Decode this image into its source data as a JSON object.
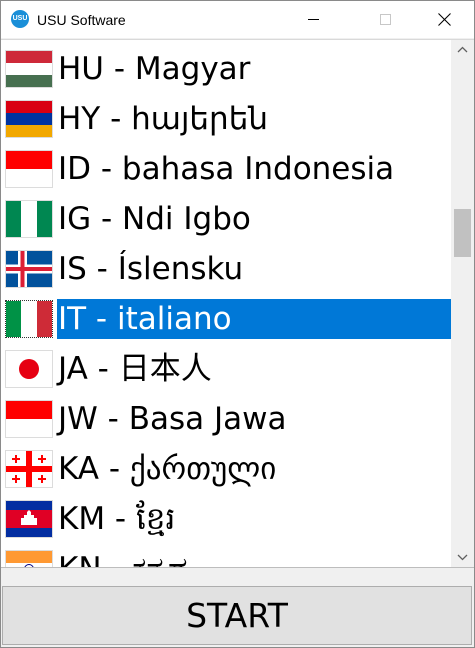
{
  "window": {
    "title": "USU Software",
    "icon_text": "USU",
    "controls": [
      "minimize",
      "maximize",
      "close"
    ]
  },
  "languages": {
    "selected_index": 5,
    "items": [
      {
        "label": "HU - Magyar",
        "flag": "flag-hungary-icon"
      },
      {
        "label": "HY - հայերեն",
        "flag": "flag-armenia-icon"
      },
      {
        "label": "ID - bahasa Indonesia",
        "flag": "flag-indonesia-icon"
      },
      {
        "label": "IG - Ndi Igbo",
        "flag": "flag-nigeria-icon"
      },
      {
        "label": "IS - Íslensku",
        "flag": "flag-iceland-icon"
      },
      {
        "label": "IT - italiano",
        "flag": "flag-italy-icon"
      },
      {
        "label": "JA - 日本人",
        "flag": "flag-japan-icon"
      },
      {
        "label": "JW - Basa Jawa",
        "flag": "flag-indonesia-icon"
      },
      {
        "label": "KA - ქართული",
        "flag": "flag-georgia-icon"
      },
      {
        "label": "KM - ខ្មែរ",
        "flag": "flag-cambodia-icon"
      },
      {
        "label": "KN - ಕನ್ನಡ",
        "flag": "flag-india-icon"
      }
    ]
  },
  "scroll": {
    "position": 0.4
  },
  "start_button": {
    "label": "START"
  },
  "colors": {
    "selection": "#0078d7",
    "titlebar": "#ffffff",
    "button_face": "#e1e1e1",
    "icon_blue": "#1a8fd8"
  }
}
